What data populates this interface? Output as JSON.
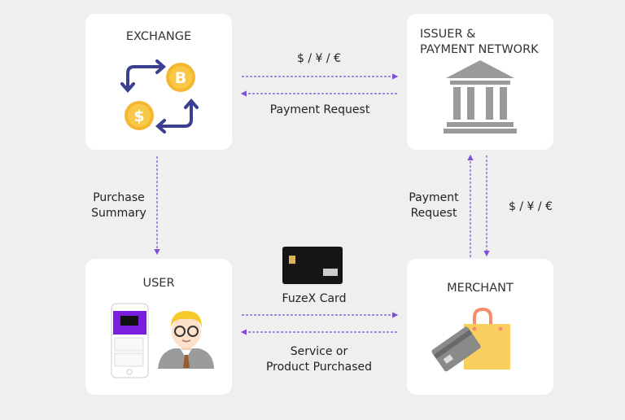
{
  "nodes": {
    "exchange": {
      "title": "EXCHANGE"
    },
    "issuer": {
      "title_line1": "ISSUER &",
      "title_line2": "PAYMENT NETWORK"
    },
    "user": {
      "title": "USER"
    },
    "merchant": {
      "title": "MERCHANT"
    }
  },
  "edges": {
    "exchange_issuer_currency": "$ / ¥ / €",
    "issuer_exchange_request": "Payment Request",
    "exchange_user_line1": "Purchase",
    "exchange_user_line2": "Summary",
    "merchant_issuer_line1": "Payment",
    "merchant_issuer_line2": "Request",
    "issuer_merchant_currency": "$ / ¥ / €",
    "user_merchant_card": "FuzeX Card",
    "merchant_user_line1": "Service or",
    "merchant_user_line2": "Product Purchased"
  },
  "colors": {
    "arrow": "#7b4fd6",
    "background": "#efefef",
    "coin": "#f5b731",
    "exchange_arrow": "#3a3f8f",
    "bank": "#9a9a9a",
    "bag": "#f9cf5f",
    "phone_header": "#7a1fe0"
  },
  "icons": [
    "exchange-cycle-icon",
    "bitcoin-coin-icon",
    "dollar-coin-icon",
    "bank-icon",
    "phone-icon",
    "user-avatar-icon",
    "fuzex-card-icon",
    "credit-card-icon",
    "shopping-bag-icon"
  ]
}
